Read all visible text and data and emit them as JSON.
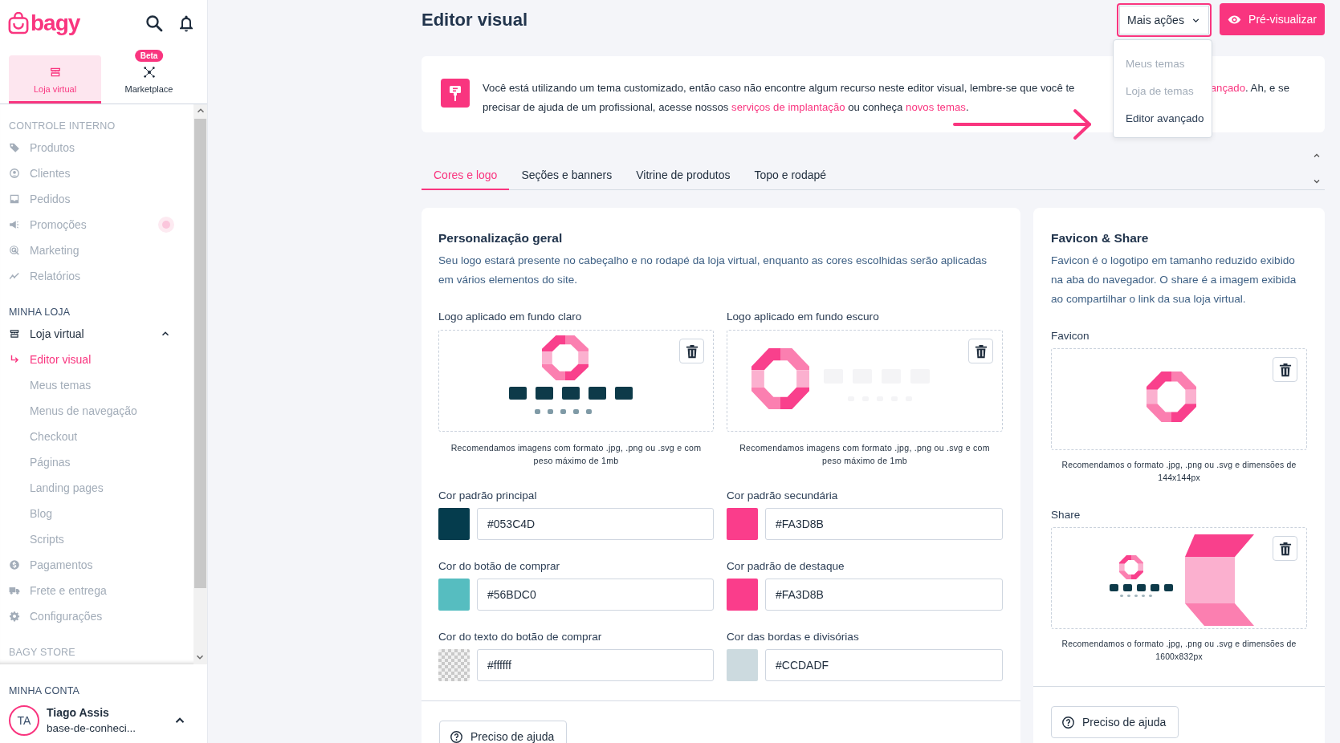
{
  "sidebar": {
    "brand": "bagy",
    "top_tabs": [
      {
        "label": "Loja virtual",
        "selected": true
      },
      {
        "label": "Marketplace",
        "badge": "Beta",
        "selected": false
      }
    ],
    "sections": [
      {
        "title": "CONTROLE INTERNO",
        "disabled": true,
        "items": [
          {
            "label": "Produtos",
            "disabled": true,
            "selected": false
          },
          {
            "label": "Clientes",
            "disabled": true,
            "selected": false
          },
          {
            "label": "Pedidos",
            "disabled": true,
            "selected": false
          },
          {
            "label": "Promoções",
            "disabled": true,
            "selected": false,
            "dot": true
          },
          {
            "label": "Marketing",
            "disabled": true,
            "selected": false
          },
          {
            "label": "Relatórios",
            "disabled": true,
            "selected": false
          }
        ]
      },
      {
        "title": "MINHA LOJA",
        "disabled": false,
        "items": [
          {
            "label": "Loja virtual",
            "disabled": false,
            "selected": false,
            "expanded": true,
            "children": [
              {
                "label": "Editor visual",
                "disabled": false,
                "selected": true
              },
              {
                "label": "Meus temas",
                "disabled": true,
                "selected": false
              },
              {
                "label": "Menus de navegação",
                "disabled": true,
                "selected": false
              },
              {
                "label": "Checkout",
                "disabled": true,
                "selected": false
              },
              {
                "label": "Páginas",
                "disabled": true,
                "selected": false
              },
              {
                "label": "Landing pages",
                "disabled": true,
                "selected": false
              },
              {
                "label": "Blog",
                "disabled": true,
                "selected": false
              },
              {
                "label": "Scripts",
                "disabled": true,
                "selected": false
              }
            ]
          },
          {
            "label": "Pagamentos",
            "disabled": true,
            "selected": false
          },
          {
            "label": "Frete e entrega",
            "disabled": true,
            "selected": false
          },
          {
            "label": "Configurações",
            "disabled": true,
            "selected": false
          }
        ]
      },
      {
        "title": "BAGY STORE",
        "disabled": true
      }
    ],
    "account": {
      "title": "MINHA CONTA",
      "initials": "TA",
      "name": "Tiago Assis",
      "subtitle": "base-de-conheci...",
      "expanded": true
    }
  },
  "header": {
    "title": "Editor visual",
    "more_button": {
      "label": "Mais ações",
      "open": true,
      "menu": [
        {
          "label": "Meus temas",
          "disabled": true
        },
        {
          "label": "Loja de temas",
          "disabled": true
        },
        {
          "label": "Editor avançado",
          "disabled": false
        }
      ]
    },
    "preview_button": {
      "label": "Pré-visualizar"
    }
  },
  "notice": {
    "lines": [
      {
        "parts": [
          [
            {
              "text": "Você está utilizando um tema customizado, então caso não encontre algum recurso neste editor visual, lembre-se que você te",
              "link": false
            }
          ],
          [
            {
              "text": "ançado",
              "link": true
            },
            {
              "text": ". Ah, e se",
              "link": false
            }
          ]
        ]
      },
      {
        "parts": [
          [
            {
              "text": "precisar de ajuda de um profissional, acesse nossos ",
              "link": false
            },
            {
              "text": "serviços de implantação",
              "link": true
            },
            {
              "text": " ou conheça ",
              "link": false
            },
            {
              "text": "novos temas",
              "link": true
            },
            {
              "text": ".",
              "link": false
            }
          ]
        ]
      }
    ]
  },
  "tabs": [
    {
      "label": "Cores e logo",
      "selected": true
    },
    {
      "label": "Seções e banners",
      "selected": false
    },
    {
      "label": "Vitrine de produtos",
      "selected": false
    },
    {
      "label": "Topo e rodapé",
      "selected": false
    }
  ],
  "general": {
    "title": "Personalização geral",
    "description": "Seu logo estará presente no cabeçalho e no rodapé da loja virtual, enquanto as cores escolhidas serão aplicadas em vários elementos do site.",
    "uploads": [
      {
        "label": "Logo aplicado em fundo claro",
        "kind": "logo_light",
        "caption": "Recomendamos imagens com formato .jpg, .png ou .svg e com peso máximo de 1mb"
      },
      {
        "label": "Logo aplicado em fundo escuro",
        "kind": "logo_dark",
        "caption": "Recomendamos imagens com formato .jpg, .png ou .svg e com peso máximo de 1mb"
      }
    ],
    "colors": [
      {
        "label": "Cor padrão principal",
        "value": "#053C4D",
        "kind": "solid",
        "color": "#053c4d"
      },
      {
        "label": "Cor padrão secundária",
        "value": "#FA3D8B",
        "kind": "solid",
        "color": "#fa3d8b"
      },
      {
        "label": "Cor do botão de comprar",
        "value": "#56BDC0",
        "kind": "solid",
        "color": "#56bdc0"
      },
      {
        "label": "Cor padrão de destaque",
        "value": "#FA3D8B",
        "kind": "solid",
        "color": "#fa3d8b"
      },
      {
        "label": "Cor do texto do botão de comprar",
        "value": "#ffffff",
        "kind": "checker"
      },
      {
        "label": "Cor das bordas e divisórias",
        "value": "#CCDADF",
        "kind": "solid",
        "color": "#ccdadf"
      }
    ],
    "help_button": "Preciso de ajuda"
  },
  "favicon_share": {
    "title": "Favicon & Share",
    "description": "Favicon é o logotipo em tamanho reduzido exibido na aba do navegador. O share é a imagem exibida ao compartilhar o link da sua loja virtual.",
    "uploads": [
      {
        "label": "Favicon",
        "kind": "mark",
        "caption": "Recomendamos o formato .jpg, .png ou .svg e dimensões de 144x144px"
      },
      {
        "label": "Share",
        "kind": "share",
        "caption": "Recomendamos o formato .jpg, .png ou .svg e dimensões de 1600x832px"
      }
    ],
    "help_button": "Preciso de ajuda"
  }
}
